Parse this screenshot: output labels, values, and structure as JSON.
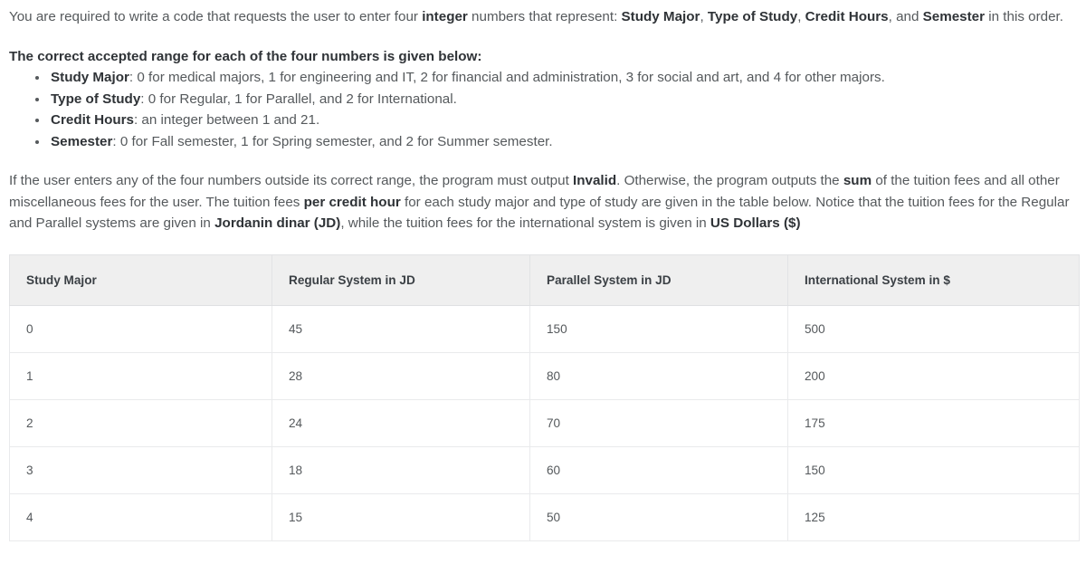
{
  "intro": {
    "text_parts": [
      {
        "t": "You are required to write a code that requests the user to enter four ",
        "b": false
      },
      {
        "t": "integer",
        "b": true
      },
      {
        "t": " numbers that represent: ",
        "b": false
      },
      {
        "t": "Study Major",
        "b": true
      },
      {
        "t": ", ",
        "b": false
      },
      {
        "t": "Type of Study",
        "b": true
      },
      {
        "t": ", ",
        "b": false
      },
      {
        "t": "Credit Hours",
        "b": true
      },
      {
        "t": ", and ",
        "b": false
      },
      {
        "t": "Semester",
        "b": true
      },
      {
        "t": " in this order.",
        "b": false
      }
    ]
  },
  "range_section": {
    "heading": "The correct accepted range for each of the four numbers is given below:",
    "items": [
      {
        "label": "Study Major",
        "desc": ": 0 for medical majors, 1 for engineering and IT, 2 for financial and administration, 3 for social and art, and 4 for other majors."
      },
      {
        "label": "Type of Study",
        "desc": ": 0 for Regular, 1 for Parallel, and 2 for International."
      },
      {
        "label": "Credit Hours",
        "desc": ": an integer between 1 and 21."
      },
      {
        "label": "Semester",
        "desc": ": 0 for Fall semester, 1 for Spring semester, and 2 for Summer semester."
      }
    ]
  },
  "output_section": {
    "text_parts": [
      {
        "t": "If the user enters any of the four numbers outside its correct range, the program must output ",
        "b": false
      },
      {
        "t": "Invalid",
        "b": true
      },
      {
        "t": ". Otherwise, the program outputs the ",
        "b": false
      },
      {
        "t": "sum",
        "b": true
      },
      {
        "t": " of the tuition fees and all other miscellaneous fees for the user. The tuition fees ",
        "b": false
      },
      {
        "t": "per credit hour",
        "b": true
      },
      {
        "t": " for each study major and type of study are given in the table below. Notice that the tuition fees for the Regular and Parallel systems are given in ",
        "b": false
      },
      {
        "t": "Jordanin dinar (JD)",
        "b": true
      },
      {
        "t": ", while the tuition fees for the international system is given in ",
        "b": false
      },
      {
        "t": "US Dollars ($)",
        "b": true
      }
    ]
  },
  "fees_table": {
    "headers": [
      "Study Major",
      "Regular System in JD",
      "Parallel System in JD",
      "International System in $"
    ],
    "rows": [
      [
        "0",
        "45",
        "150",
        "500"
      ],
      [
        "1",
        "28",
        "80",
        "200"
      ],
      [
        "2",
        "24",
        "70",
        "175"
      ],
      [
        "3",
        "18",
        "60",
        "150"
      ],
      [
        "4",
        "15",
        "50",
        "125"
      ]
    ]
  },
  "colors": {
    "body_text": "#55595c",
    "bold_text": "#2f3337",
    "table_header_bg": "#efefef",
    "table_border": "#e9eaec",
    "page_bg": "#ffffff"
  }
}
